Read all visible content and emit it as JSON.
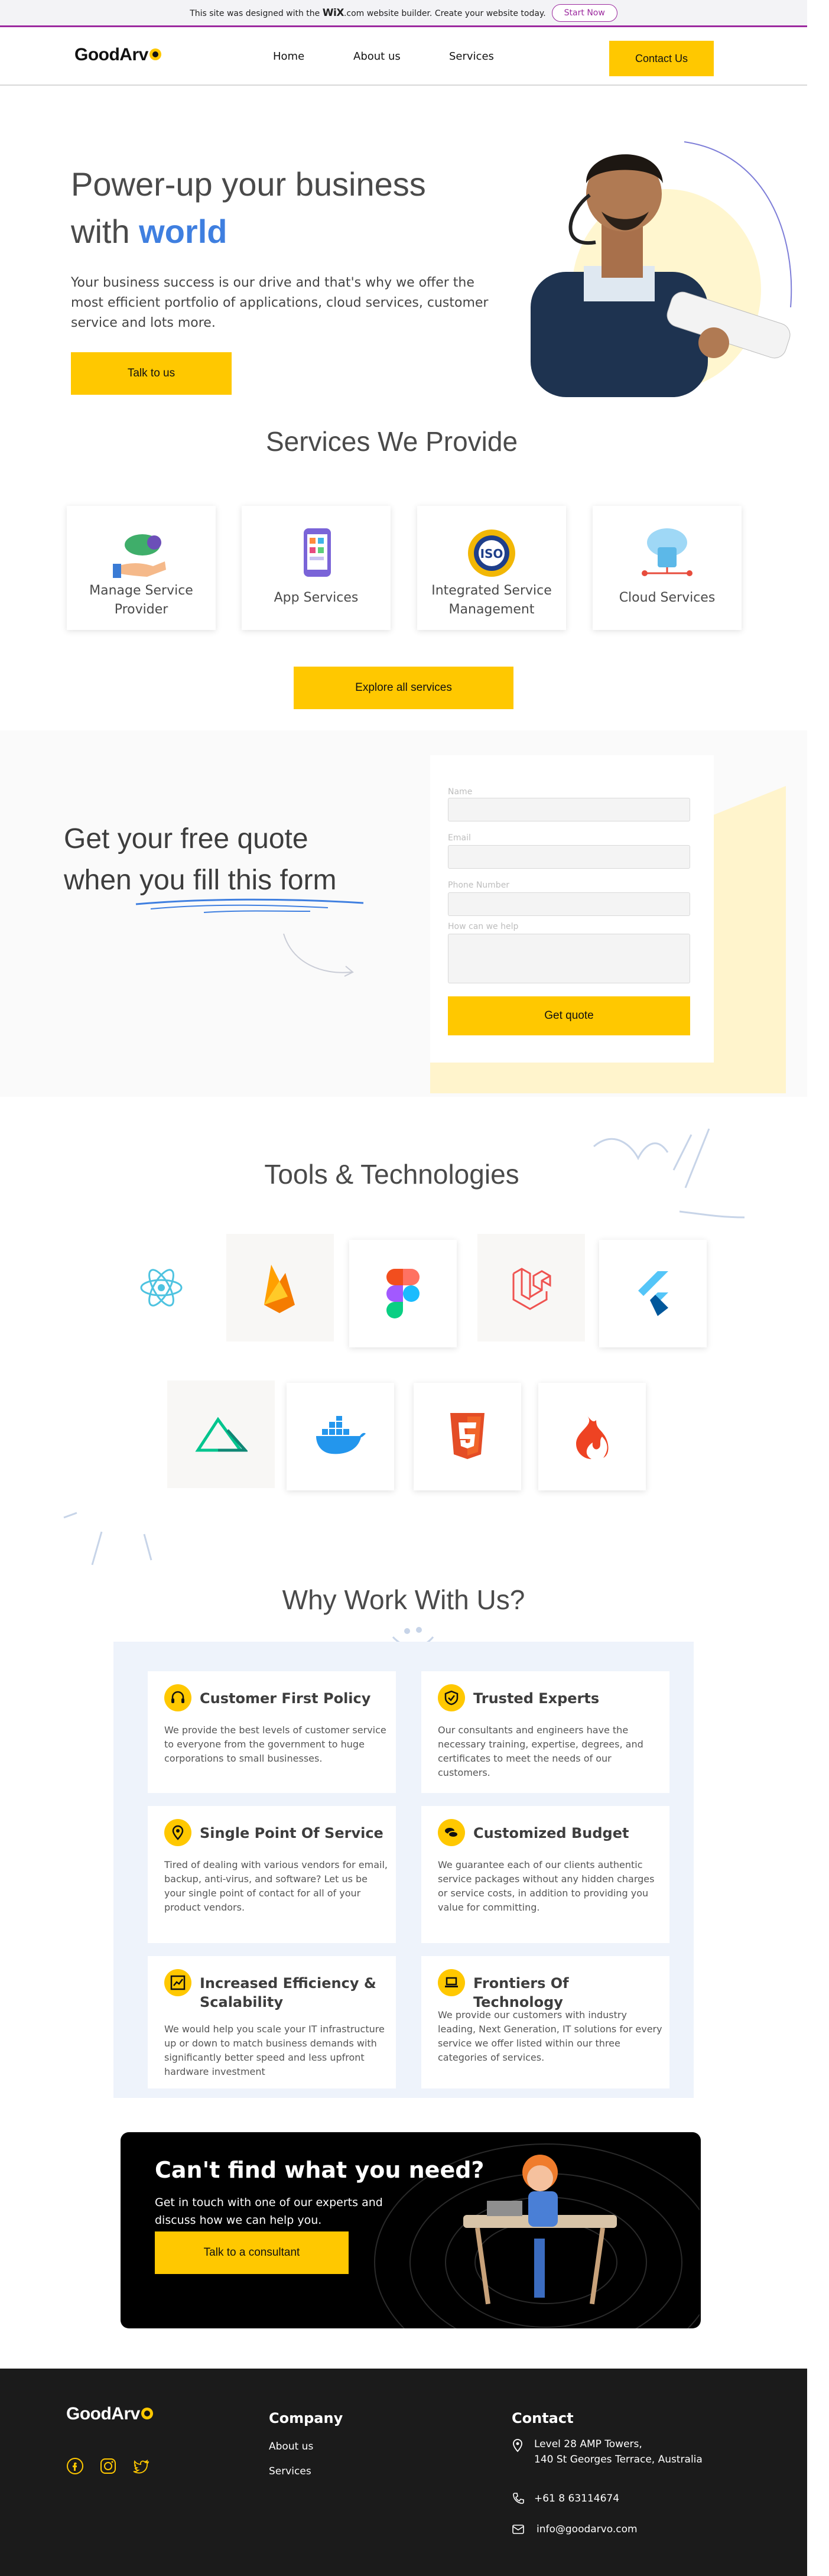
{
  "wixbar": {
    "text_before": "This site was designed with the",
    "wix_logo": "WiX",
    "text_after": ".com website builder. Create your website today.",
    "start_now": "Start Now"
  },
  "header": {
    "logo": "GoodArv",
    "nav": [
      "Home",
      "About us",
      "Services"
    ],
    "cta": "Contact Us"
  },
  "hero": {
    "title_line1": "Power-up your business",
    "title_with": "with",
    "title_highlight": "world",
    "subtitle": "Your business success is our drive and that's why we offer the most efficient portfolio of applications, cloud services, customer service and lots more.",
    "cta": "Talk to us"
  },
  "services": {
    "title": "Services We Provide",
    "items": [
      {
        "label": "Manage Service Provider",
        "icon": "hand-cloud-icon"
      },
      {
        "label": "App Services",
        "icon": "mobile-app-icon"
      },
      {
        "label": "Integrated Service Management",
        "icon": "iso-badge-icon"
      },
      {
        "label": "Cloud Services",
        "icon": "cloud-database-icon"
      }
    ],
    "cta": "Explore all services"
  },
  "quote": {
    "title_line1": "Get your free quote",
    "title_line2": "when you fill this form",
    "fields": [
      {
        "label": "Name",
        "value": ""
      },
      {
        "label": "Email",
        "value": ""
      },
      {
        "label": "Phone Number",
        "value": ""
      },
      {
        "label": "How can we help",
        "value": ""
      }
    ],
    "submit": "Get quote"
  },
  "tools": {
    "title": "Tools & Technologies",
    "items": [
      "react-icon",
      "firebase-icon",
      "figma-icon",
      "laravel-icon",
      "flutter-icon",
      "nuxt-icon",
      "docker-icon",
      "html5-icon",
      "codeigniter-icon"
    ]
  },
  "why": {
    "title": "Why Work With Us?",
    "items": [
      {
        "title": "Customer First Policy",
        "text": "We provide the best levels of customer service to everyone from the government to huge corporations to small businesses.",
        "icon": "headset-icon"
      },
      {
        "title": "Trusted Experts",
        "text": "Our consultants and engineers have the necessary training, expertise, degrees, and certificates to meet the needs of our customers.",
        "icon": "shield-check-icon"
      },
      {
        "title": "Single Point Of Service",
        "text": "Tired of dealing with various vendors for email, backup, anti-virus, and software? Let us be your single point of contact for all of your product vendors.",
        "icon": "location-pin-icon"
      },
      {
        "title": "Customized Budget",
        "text": "We guarantee each of our clients authentic service packages without any hidden charges or service costs, in addition to providing you value for committing.",
        "icon": "coins-icon"
      },
      {
        "title": "Increased Efficiency & Scalability",
        "text": "We would help you scale your IT infrastructure up or down to match business demands with significantly better speed and less upfront hardware investment",
        "icon": "trend-chart-icon"
      },
      {
        "title": "Frontiers Of Technology",
        "text": "We provide our customers with industry leading, Next Generation, IT solutions for every service we offer listed within our three categories of services.",
        "icon": "laptop-icon"
      }
    ]
  },
  "cta": {
    "title": "Can't find what you need?",
    "text": "Get in touch with one of our experts and discuss how we can help you.",
    "button": "Talk to a consultant"
  },
  "footer": {
    "logo": "GoodArv",
    "company_heading": "Company",
    "company_links": [
      "About us",
      "Services"
    ],
    "contact_heading": "Contact",
    "address_line1": "Level 28 AMP Towers,",
    "address_line2": "140 St Georges Terrace, Australia",
    "phone": "+61 8 63114674",
    "email": "info@goodarvo.com"
  },
  "colors": {
    "accent": "#ffc800",
    "highlight": "#3f7fe0",
    "wix_purple": "#9c2a9f",
    "footer_bg": "#1b1b1b"
  }
}
